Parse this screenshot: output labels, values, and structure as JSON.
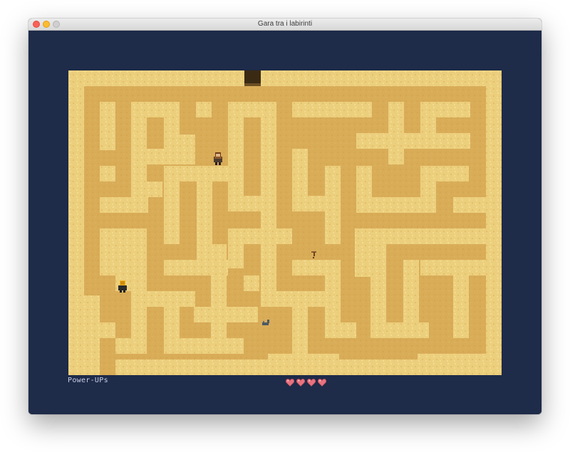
{
  "window": {
    "title": "Gara tra i labirinti"
  },
  "colors": {
    "background": "#1e2b49",
    "wall_sand": "#eccf7c",
    "path_sand": "#d9ac58",
    "exit_dark": "#3a2a14",
    "heart": "#e8737f"
  },
  "hud": {
    "powerups_label": "Power-UPs",
    "lives": 4
  },
  "entities": {
    "player": "player-character",
    "opponent": "opponent-character",
    "items": [
      "scorpion-item",
      "pickaxe-item"
    ]
  }
}
